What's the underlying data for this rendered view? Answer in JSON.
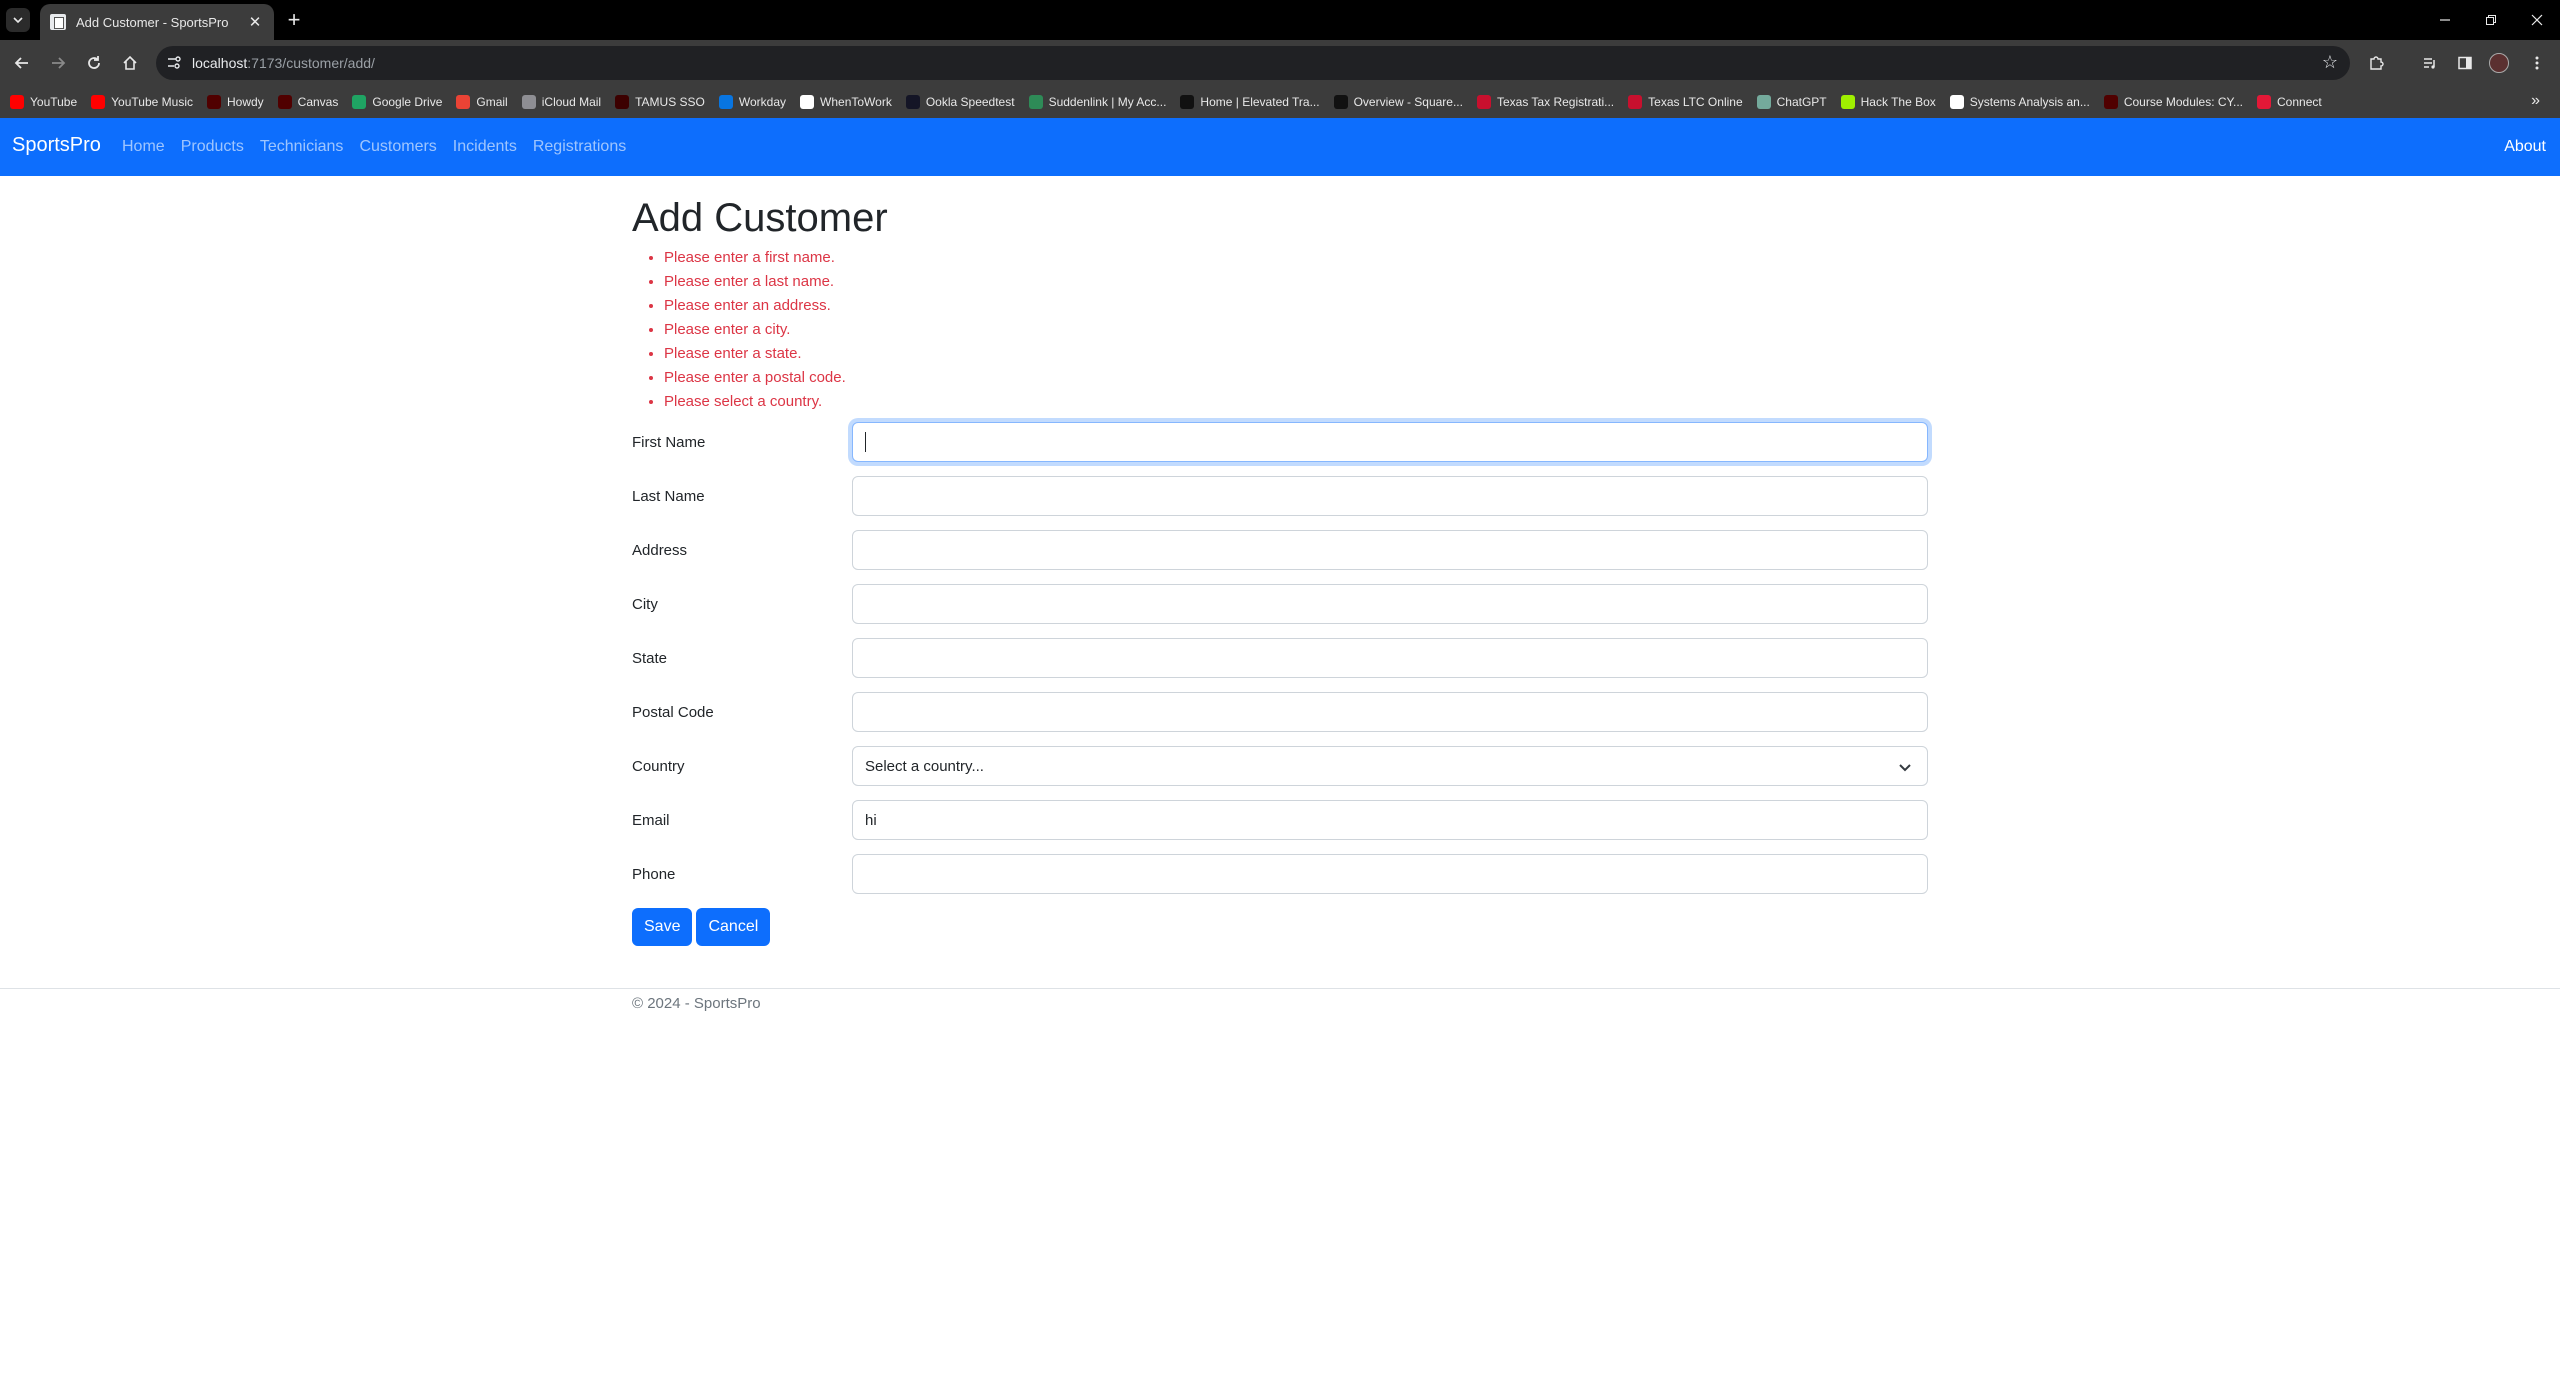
{
  "browser": {
    "tab_title": "Add Customer - SportsPro",
    "url_host": "localhost",
    "url_path": ":7173/customer/add/",
    "bookmarks": [
      {
        "label": "YouTube",
        "color": "#ff0000"
      },
      {
        "label": "YouTube Music",
        "color": "#ff0000"
      },
      {
        "label": "Howdy",
        "color": "#500000"
      },
      {
        "label": "Canvas",
        "color": "#500000"
      },
      {
        "label": "Google Drive",
        "color": "#1fa463"
      },
      {
        "label": "Gmail",
        "color": "#ea4335"
      },
      {
        "label": "iCloud Mail",
        "color": "#8e8e93"
      },
      {
        "label": "TAMUS SSO",
        "color": "#3c0000"
      },
      {
        "label": "Workday",
        "color": "#0875e1"
      },
      {
        "label": "WhenToWork",
        "color": "#ffffff"
      },
      {
        "label": "Ookla Speedtest",
        "color": "#141526"
      },
      {
        "label": "Suddenlink | My Acc...",
        "color": "#2e8b57"
      },
      {
        "label": "Home | Elevated Tra...",
        "color": "#111111"
      },
      {
        "label": "Overview - Square...",
        "color": "#111111"
      },
      {
        "label": "Texas Tax Registrati...",
        "color": "#c8102e"
      },
      {
        "label": "Texas LTC Online",
        "color": "#c8102e"
      },
      {
        "label": "ChatGPT",
        "color": "#74aa9c"
      },
      {
        "label": "Hack The Box",
        "color": "#9fef00"
      },
      {
        "label": "Systems Analysis an...",
        "color": "#ffffff"
      },
      {
        "label": "Course Modules: CY...",
        "color": "#500000"
      },
      {
        "label": "Connect",
        "color": "#e31837"
      }
    ]
  },
  "nav": {
    "brand": "SportsPro",
    "links": [
      "Home",
      "Products",
      "Technicians",
      "Customers",
      "Incidents",
      "Registrations"
    ],
    "about": "About"
  },
  "main": {
    "title": "Add Customer",
    "errors": [
      "Please enter a first name.",
      "Please enter a last name.",
      "Please enter an address.",
      "Please enter a city.",
      "Please enter a state.",
      "Please enter a postal code.",
      "Please select a country."
    ],
    "fields": {
      "first_name": {
        "label": "First Name",
        "value": ""
      },
      "last_name": {
        "label": "Last Name",
        "value": ""
      },
      "address": {
        "label": "Address",
        "value": ""
      },
      "city": {
        "label": "City",
        "value": ""
      },
      "state": {
        "label": "State",
        "value": ""
      },
      "postal_code": {
        "label": "Postal Code",
        "value": ""
      },
      "country": {
        "label": "Country",
        "selected": "Select a country..."
      },
      "email": {
        "label": "Email",
        "value": "hi"
      },
      "phone": {
        "label": "Phone",
        "value": ""
      }
    },
    "save_label": "Save",
    "cancel_label": "Cancel"
  },
  "footer": {
    "text": "© 2024 - SportsPro"
  },
  "colors": {
    "primary": "#0d6efd",
    "danger": "#dc3545"
  }
}
